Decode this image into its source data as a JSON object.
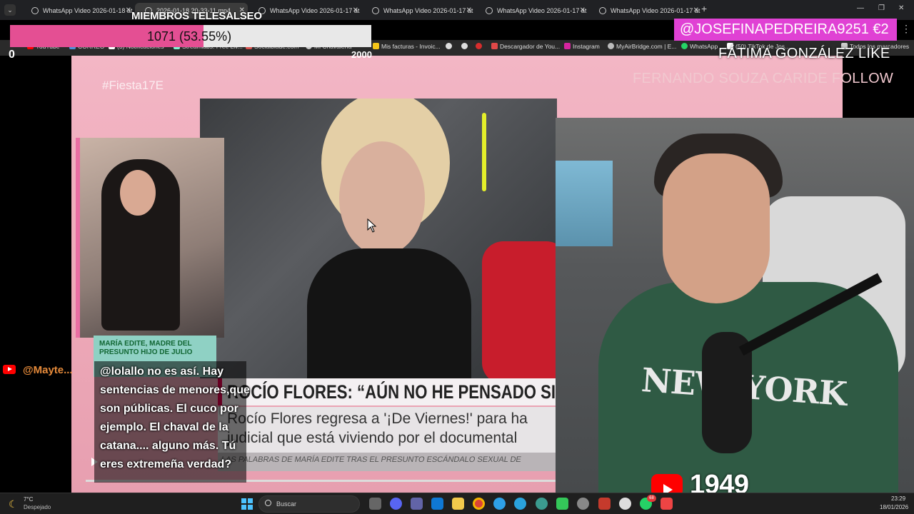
{
  "browser": {
    "tabs": [
      {
        "title": "WhatsApp Video 2026-01-18 at",
        "active": false
      },
      {
        "title": "2026-01-18 20-33-11.mp4",
        "active": true
      },
      {
        "title": "WhatsApp Video 2026-01-17 at",
        "active": false
      },
      {
        "title": "WhatsApp Video 2026-01-17 at",
        "active": false
      },
      {
        "title": "WhatsApp Video 2026-01-17 at",
        "active": false
      },
      {
        "title": "WhatsApp Video 2026-01-17 at",
        "active": false
      }
    ],
    "bookmarks": [
      {
        "label": "YouTube",
        "icon": "youtube-icon",
        "color": "#ff0000"
      },
      {
        "label": "CORREO",
        "icon": "mail-icon",
        "color": "#4a90d9"
      },
      {
        "label": "(3) Notificaciones",
        "icon": "x-icon",
        "color": "#ffffff"
      },
      {
        "label": "Streamlabs: Free Liv...",
        "icon": "streamlabs-icon",
        "color": "#80f5d2"
      },
      {
        "label": "Socialblade.com",
        "icon": "socialblade-icon",
        "color": "#d9534f"
      },
      {
        "label": "Mi Chavalería",
        "icon": "globe-icon",
        "color": "#cccccc"
      },
      {
        "label": "Mis facturas - Invoic...",
        "icon": "invoice-icon",
        "color": "#f5c518"
      },
      {
        "label": "",
        "icon": "circle-icon",
        "color": "#dddddd"
      },
      {
        "label": "",
        "icon": "circle-icon",
        "color": "#dddddd"
      },
      {
        "label": "",
        "icon": "apple-icon",
        "color": "#d62d2d"
      },
      {
        "label": "Descargador de You...",
        "icon": "download-icon",
        "color": "#e04848"
      },
      {
        "label": "Instagram",
        "icon": "instagram-icon",
        "color": "#d6249f"
      },
      {
        "label": "MyAirBridge.com | E...",
        "icon": "cloud-icon",
        "color": "#bbbbbb"
      },
      {
        "label": "WhatsApp",
        "icon": "whatsapp-icon",
        "color": "#25d366"
      },
      {
        "label": "(50) TikTok de Jos...",
        "icon": "tiktok-icon",
        "color": "#ffffff"
      },
      {
        "label": "Todos los marcadores",
        "icon": "folder-icon",
        "color": "#cccccc"
      }
    ]
  },
  "overlays": {
    "members_title": "MIEMBROS TELESALSEO",
    "members_value": "1071 (53.55%)",
    "members_progress": 0.5355,
    "goal_start": "0",
    "goal_end": "2000",
    "donation": "@JOSEFINAPEDREIRA9251  €2",
    "like_line": "FÁTIMA GONZÁLEZ  LIKE",
    "follow_line": "FERNANDO SOUZA CARIDE  FOLLOW",
    "youtube_count": "1949"
  },
  "video": {
    "hashtag": "#Fiesta17E",
    "guest_caption": "MARÍA EDITE, MADRE DEL PRESUNTO HIJO DE JULIO",
    "headline": "ROCÍO FLORES: “AÚN NO HE PENSADO SI VOY A I",
    "sub_line_1": "Rocío Flores regresa a '¡De Viernes!' para ha",
    "sub_line_2": "judicial que está viviendo por el documental",
    "ticker": "LAS PALABRAS DE MARÍA EDITE TRAS EL PRESUNTO ESCÁNDALO SEXUAL DE"
  },
  "chat": {
    "username": "@Mayte...",
    "message": "@lolallo no es así. Hay sentencias de menores,que son públicas. El cuco por ejemplo. El chaval de la catana.... alguno más. Tú eres extremeña verdad?"
  },
  "taskbar": {
    "weather_temp": "7°C",
    "weather_desc": "Despejado",
    "search_placeholder": "Buscar",
    "time": "23:29",
    "date": "18/01/2026",
    "whatsapp_badge": "68"
  }
}
